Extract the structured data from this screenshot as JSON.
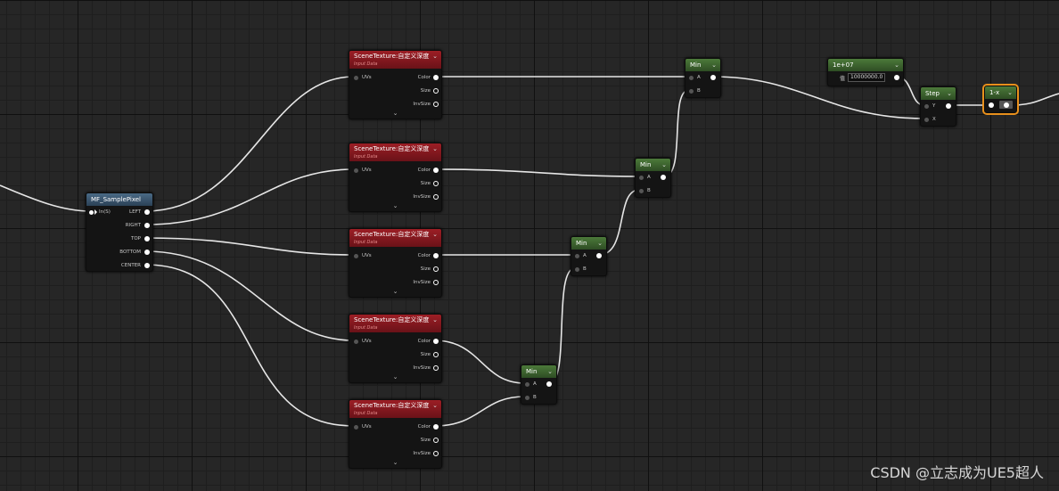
{
  "scene_texture": {
    "title": "SceneTexture:自定义深度",
    "subtitle": "Input Data",
    "uvs": "UVs",
    "color": "Color",
    "size": "Size",
    "invsize": "InvSize",
    "expand": "⌄"
  },
  "min_node": {
    "title": "Min",
    "a": "A",
    "b": "B"
  },
  "sample_pixel": {
    "title": "MF_SamplePixel",
    "input": "In(S)",
    "outputs": [
      "LEFT",
      "RIGHT",
      "TOP",
      "BOTTOM",
      "CENTER"
    ]
  },
  "constant": {
    "title": "1e+07",
    "label": "值",
    "value": "10000000.0"
  },
  "step": {
    "title": "Step",
    "y": "Y",
    "x": "X"
  },
  "one_minus": {
    "title": "1-x"
  },
  "watermark": "CSDN @立志成为UE5超人",
  "colors": {
    "texture_header": "#9c1e25",
    "math_header": "#4c7a3a",
    "function_header": "#4a6a86",
    "selection": "#e8901c",
    "wire": "#ffffff"
  }
}
